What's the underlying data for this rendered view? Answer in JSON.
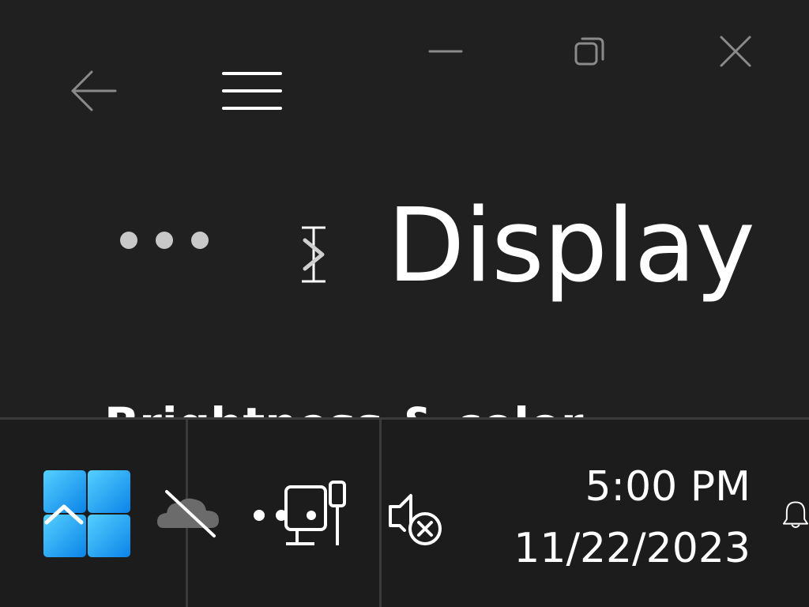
{
  "window": {
    "title": "Display",
    "section_heading": "Brightness & color",
    "controls": {
      "minimize": "minimize-icon",
      "restore": "restore-icon",
      "close": "close-icon"
    },
    "nav": {
      "back": "back-arrow-icon",
      "menu": "hamburger-menu-icon",
      "more": "more-options-icon"
    }
  },
  "taskbar": {
    "start": "windows-start-icon",
    "onedrive": "onedrive-off-icon",
    "network": "ethernet-network-icon",
    "volume": "volume-muted-icon",
    "notifications": "notification-bell-icon",
    "clock": {
      "time": "5:00 PM",
      "date": "11/22/2023"
    }
  },
  "colors": {
    "window_bg": "#202020",
    "taskbar_bg": "#1c1c1c",
    "divider": "#3a3a3a",
    "icon_muted": "#8a8a8a",
    "text": "#ffffff",
    "start_blue_light": "#4cc2ff",
    "start_blue_dark": "#0078d4"
  }
}
